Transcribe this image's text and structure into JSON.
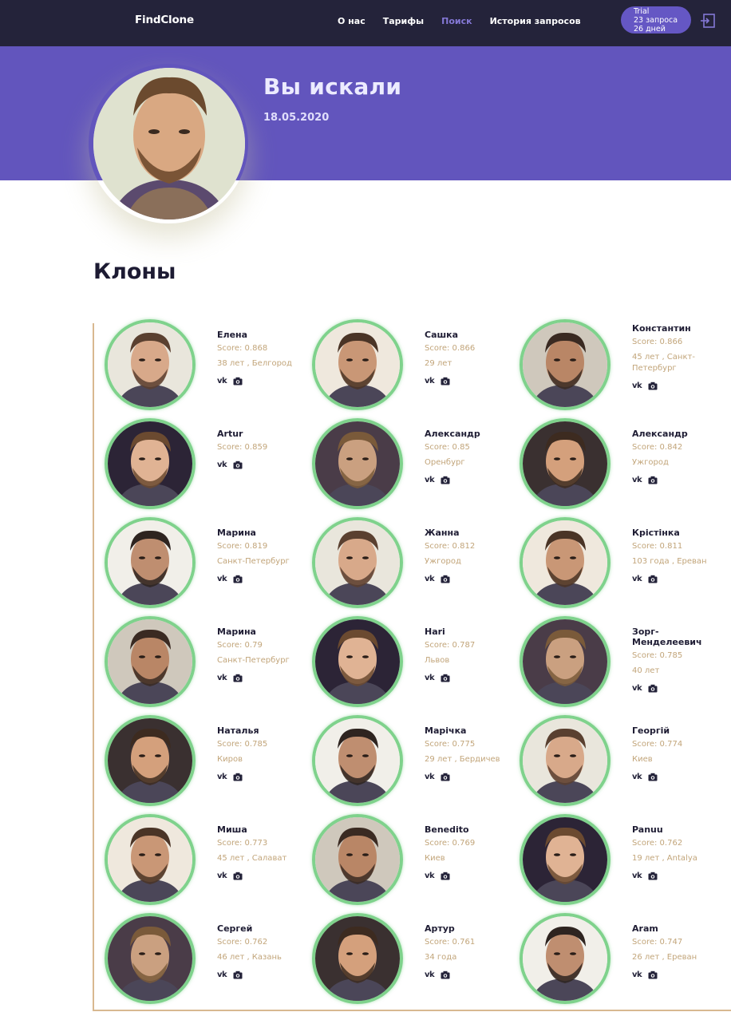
{
  "header": {
    "logo": "FindClone",
    "nav": [
      "О нас",
      "Тарифы",
      "Поиск",
      "История запросов"
    ],
    "active_nav": "Поиск",
    "trial": {
      "plan": "Trial",
      "requests": "23 запроса",
      "days": "26 дней"
    },
    "logout_icon": "logout-icon"
  },
  "hero": {
    "title": "Вы искали",
    "date": "18.05.2020"
  },
  "section_title": "Клоны",
  "colors": {
    "nav_bg": "#24233a",
    "hero_bg": "#6255bd",
    "accent": "#8478d6",
    "avatar_ring": "#7fd28c",
    "muted_text": "#c2a57a",
    "timeline": "#d8b890"
  },
  "clones": [
    {
      "name": "Елена",
      "score": "Score: 0.868",
      "location": "38 лет , Белгород"
    },
    {
      "name": "Сашка",
      "score": "Score: 0.866",
      "location": "29 лет"
    },
    {
      "name": "Константин",
      "score": "Score: 0.866",
      "location": "45 лет , Санкт-Петербург"
    },
    {
      "name": "Artur",
      "score": "Score: 0.859",
      "location": ""
    },
    {
      "name": "Александр",
      "score": "Score: 0.85",
      "location": "Оренбург"
    },
    {
      "name": "Александр",
      "score": "Score: 0.842",
      "location": "Ужгород"
    },
    {
      "name": "Марина",
      "score": "Score: 0.819",
      "location": "Санкт-Петербург"
    },
    {
      "name": "Жанна",
      "score": "Score: 0.812",
      "location": "Ужгород"
    },
    {
      "name": "Крістінка",
      "score": "Score: 0.811",
      "location": "103 года , Ереван"
    },
    {
      "name": "Марина",
      "score": "Score: 0.79",
      "location": "Санкт-Петербург"
    },
    {
      "name": "Hari",
      "score": "Score: 0.787",
      "location": "Львов"
    },
    {
      "name": "Зорг-Менделеевич",
      "score": "Score: 0.785",
      "location": "40 лет"
    },
    {
      "name": "Наталья",
      "score": "Score: 0.785",
      "location": "Киров"
    },
    {
      "name": "Марічка",
      "score": "Score: 0.775",
      "location": "29 лет , Бердичев"
    },
    {
      "name": "Георгій",
      "score": "Score: 0.774",
      "location": "Киев"
    },
    {
      "name": "Миша",
      "score": "Score: 0.773",
      "location": "45 лет , Салават"
    },
    {
      "name": "Benedito",
      "score": "Score: 0.769",
      "location": "Киев"
    },
    {
      "name": "Panuu",
      "score": "Score: 0.762",
      "location": "19 лет , Antalya"
    },
    {
      "name": "Сергей",
      "score": "Score: 0.762",
      "location": "46 лет , Казань"
    },
    {
      "name": "Артур",
      "score": "Score: 0.761",
      "location": "34 года"
    },
    {
      "name": "Aram",
      "score": "Score: 0.747",
      "location": "26 лет , Ереван"
    }
  ],
  "vk_label": "vk",
  "camera_icon": "camera-icon"
}
